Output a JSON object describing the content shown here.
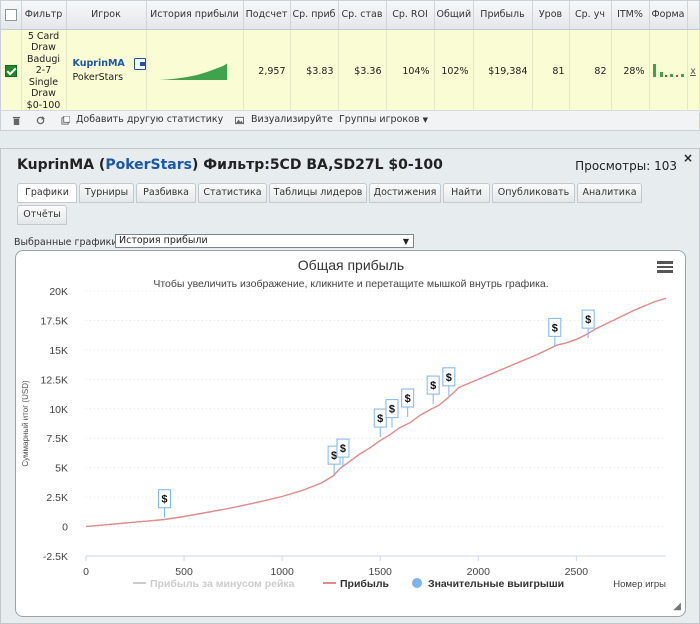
{
  "stats_table": {
    "headers": [
      "",
      "Фильтр",
      "Игрок",
      "История прибыли",
      "Подсчет",
      "Ср. приб",
      "Ср. став",
      "Ср. ROI",
      "Общий",
      "Прибыль",
      "Уров",
      "Ср. уч",
      "ITM%",
      "Форма",
      ""
    ],
    "row": {
      "checked": true,
      "filter": "5 Card Draw Badugi 2-7 Single Draw $0-100",
      "player_name": "KuprinMA",
      "player_site": "PokerStars",
      "count": "2,957",
      "avg_profit": "$3.83",
      "avg_stake": "$3.36",
      "avg_roi": "104%",
      "total_roi": "102%",
      "profit": "$19,384",
      "level": "81",
      "avg_entrants": "82",
      "itm": "28%",
      "remove": "x"
    },
    "toolbar": {
      "add_stat": "Добавить другую статистику",
      "visualize": "Визуализируйте",
      "player_groups": "Группы игроков"
    }
  },
  "window": {
    "title_player": "KuprinMA",
    "title_site": "PokerStars",
    "title_filter": "Фильтр:5CD BA,SD27L $0-100",
    "views": "Просмотры: 103",
    "close": "×",
    "tabs": [
      "Графики",
      "Турниры",
      "Разбивка",
      "Статистика",
      "Таблицы лидеров",
      "Достижения",
      "Найти",
      "Опубликовать",
      "Аналитика",
      "Отчёты"
    ],
    "active_tab": "Графики",
    "graph_select_label": "Выбранные графики:",
    "graph_select_value": "История прибыли"
  },
  "chart_data": {
    "type": "line",
    "title": "Общая прибыль",
    "subtitle": "Чтобы увеличить изображение, кликните и перетащите мышкой внутрь графика.",
    "xlabel": "Номер игры",
    "ylabel": "Суммарный итог (USD)",
    "xlim": [
      0,
      2957
    ],
    "ylim": [
      -2500,
      20000
    ],
    "x_ticks": [
      "0",
      "500",
      "1000",
      "1500",
      "2000",
      "2500"
    ],
    "y_ticks": [
      "-2.5K",
      "0",
      "2.5K",
      "5K",
      "7.5K",
      "10K",
      "12.5K",
      "15K",
      "17.5K",
      "20K"
    ],
    "grid": true,
    "legend_position": "bottom",
    "series": [
      {
        "name": "Прибыль",
        "color": "#e08a8a",
        "x": [
          0,
          100,
          200,
          300,
          400,
          500,
          600,
          700,
          800,
          900,
          1000,
          1100,
          1200,
          1260,
          1300,
          1350,
          1400,
          1450,
          1500,
          1550,
          1600,
          1650,
          1700,
          1750,
          1800,
          1850,
          1900,
          2000,
          2100,
          2200,
          2300,
          2400,
          2450,
          2500,
          2550,
          2600,
          2700,
          2800,
          2900,
          2957
        ],
        "y": [
          0,
          150,
          300,
          450,
          600,
          850,
          1150,
          1450,
          1800,
          2150,
          2550,
          3050,
          3700,
          4300,
          5000,
          5600,
          6200,
          6700,
          7300,
          7800,
          8400,
          8800,
          9400,
          9900,
          10300,
          11000,
          11800,
          12500,
          13200,
          13900,
          14600,
          15400,
          15600,
          15900,
          16300,
          16800,
          17600,
          18400,
          19100,
          19384
        ]
      },
      {
        "name": "Прибыль за минусом рейка",
        "color": "#cccccc",
        "x": [],
        "y": []
      }
    ],
    "markers": {
      "name": "Значительные выигрыши",
      "color": "#7cb5ec",
      "label": "$",
      "x": [
        400,
        1265,
        1310,
        1500,
        1560,
        1640,
        1770,
        1850,
        2390,
        2560
      ],
      "y": [
        750,
        4450,
        5050,
        7600,
        8400,
        9300,
        10400,
        11100,
        15300,
        16000
      ]
    }
  }
}
